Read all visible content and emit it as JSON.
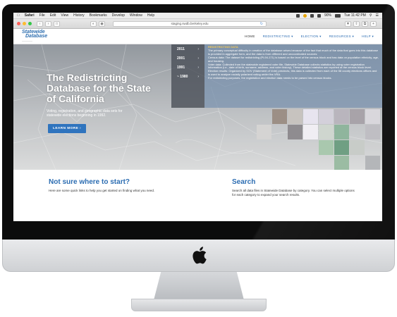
{
  "menubar": {
    "items": [
      "Safari",
      "File",
      "Edit",
      "View",
      "History",
      "Bookmarks",
      "Develop",
      "Window",
      "Help"
    ],
    "battery": "90%",
    "clock": "Tue 11:42 PM"
  },
  "browser": {
    "url": "staging.swdb.berkeley.edu"
  },
  "site": {
    "logo_line1": "Statewide",
    "logo_line2": "Database",
    "nav": [
      "HOME",
      "REDISTRICTING ▾",
      "ELECTION ▾",
      "RESOURCES ▾",
      "HELP ▾"
    ]
  },
  "hero": {
    "title": "The Redistricting Database for the State of California",
    "subtitle": "Voting, registration, and geographic data sets for statewide elections beginning in 1992.",
    "button": "LEARN MORE ›",
    "years": [
      "2011",
      "2001",
      "1991",
      "~ 1980"
    ],
    "info_title": "REDISTRICTING DATA",
    "info_lines": [
      "The primary conceptual difficulty in creation of the database arises because of the fact that much of the data that goes into this database is provided in aggregate form, and the data is from different and uncoordinated sources:",
      "Census data: The dataset for redistricting (PL94-171) is based on the level of the census block and has data on population ethnicity, age, and housing.",
      "Voter data: Collected from the statewide registered voter file, Statewide Database collects statistics by using voter registration information (i.e., date of birth, surname, address, and voter history). These detailed statistics are reported at the census block level.",
      "Election results: Organized by SOV (Statement of Vote) precincts, this data is collected from each of the 58 county elections offices and is used to analyze racially polarized voting under the VRA.",
      "For redistricting purposes, the registration and election data needs to be parsed into census blocks."
    ]
  },
  "sections": {
    "left_heading": "Not sure where to start?",
    "left_text": "Here are some quick links to help you get started on finding what you need.",
    "right_heading": "Search",
    "right_text": "Search all data files in Statewide Database by category. You can select multiple options for each category to expand your search results."
  }
}
